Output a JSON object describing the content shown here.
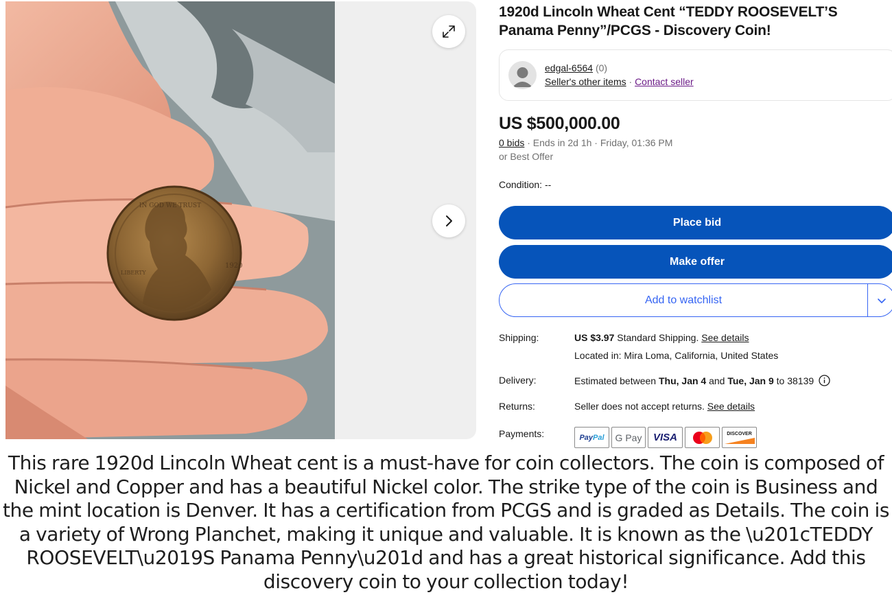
{
  "listing": {
    "title": "1920d Lincoln Wheat Cent “TEDDY ROOSEVELT’S Panama Penny”/PCGS - Discovery Coin!"
  },
  "gallery": {
    "expand_icon": "expand-arrows-icon",
    "next_icon": "chevron-right-icon"
  },
  "seller": {
    "name": "edgal-6564",
    "feedback": "(0)",
    "other_items": "Seller's other items",
    "separator": "·",
    "contact": "Contact seller"
  },
  "price": {
    "amount": "US $500,000.00",
    "bids": "0 bids",
    "ends": "· Ends in 2d 1h · Friday, 01:36 PM",
    "best_offer": "or Best Offer"
  },
  "condition": {
    "label": "Condition:",
    "value": "--"
  },
  "actions": {
    "place_bid": "Place bid",
    "make_offer": "Make offer",
    "add_to_watchlist": "Add to watchlist"
  },
  "shipping": {
    "label": "Shipping:",
    "cost": "US $3.97",
    "method": " Standard Shipping. ",
    "details_link": "See details",
    "location": "Located in: Mira Loma, California, United States"
  },
  "delivery": {
    "label": "Delivery:",
    "prefix": "Estimated between ",
    "start": "Thu, Jan 4",
    "and": " and ",
    "end": "Tue, Jan 9",
    "to": " to 38139"
  },
  "returns": {
    "label": "Returns:",
    "text": "Seller does not accept returns. ",
    "details_link": "See details"
  },
  "payments": {
    "label": "Payments:",
    "paypal_a": "Pay",
    "paypal_b": "Pal",
    "gpay": "G Pay",
    "visa": "VISA",
    "discover": "DISCOVER"
  },
  "description": {
    "text": "This rare 1920d Lincoln Wheat cent is a must-have for coin collectors. The coin is composed of Nickel and Copper and has a beautiful Nickel color. The strike type of the coin is Business and the mint location is Denver. It has a certification from PCGS and is graded as Details. The coin is a variety of Wrong Planchet, making it unique and valuable. It is known as the \\u201cTEDDY ROOSEVELT\\u2019S Panama Penny\\u201d and has a great historical significance. Add this discovery coin to your collection today!"
  },
  "colors": {
    "primary_button": "#0654ba",
    "watchlist_blue": "#3665f3",
    "contact_purple": "#6b1b87"
  }
}
